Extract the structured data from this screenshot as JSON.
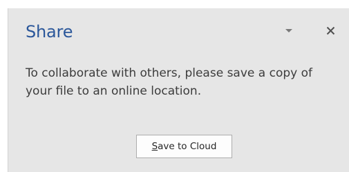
{
  "pane": {
    "title": "Share",
    "message": "To collaborate with others, please save a copy of your file to an online location.",
    "accent_color": "#2b579a",
    "background_color": "#e6e6e6"
  },
  "controls": {
    "dropdown_icon": "chevron-down-icon",
    "close_icon": "close-icon"
  },
  "button": {
    "accelerator": "S",
    "label_rest": "ave to Cloud"
  }
}
